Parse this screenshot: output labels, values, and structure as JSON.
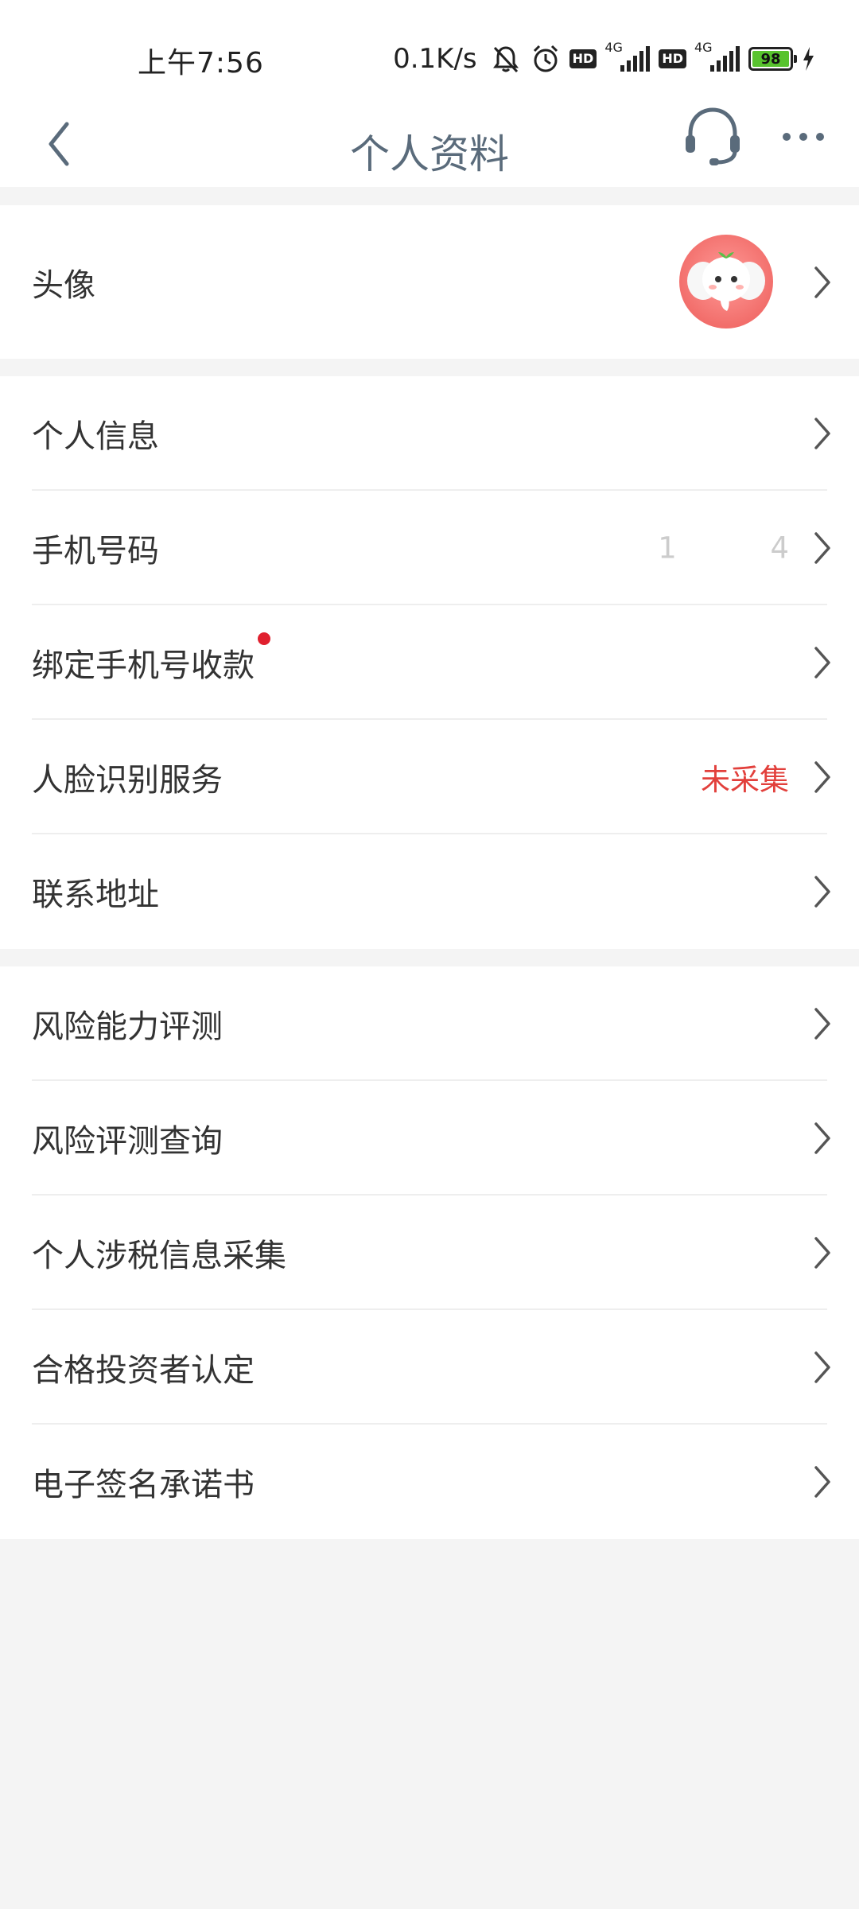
{
  "status_bar": {
    "time": "上午7:56",
    "net_speed": "0.1K/s",
    "signal_label_1": "4G",
    "signal_label_2": "4G",
    "hd_label": "HD",
    "battery": "98"
  },
  "nav": {
    "title": "个人资料"
  },
  "profile": {
    "avatar_label": "头像"
  },
  "personal_section": {
    "items": [
      {
        "label": "个人信息",
        "value": ""
      },
      {
        "label": "手机号码",
        "value": "1          4"
      },
      {
        "label": "绑定手机号收款",
        "value": ""
      },
      {
        "label": "人脸识别服务",
        "value": "未采集"
      },
      {
        "label": "联系地址",
        "value": ""
      }
    ]
  },
  "risk_section": {
    "items": [
      {
        "label": "风险能力评测"
      },
      {
        "label": "风险评测查询"
      },
      {
        "label": "个人涉税信息采集"
      },
      {
        "label": "合格投资者认定"
      },
      {
        "label": "电子签名承诺书"
      }
    ]
  },
  "colors": {
    "title": "#5a6b7b",
    "accent_red": "#e2403c",
    "dot_red": "#e0202e",
    "page_bg": "#f4f4f4"
  }
}
